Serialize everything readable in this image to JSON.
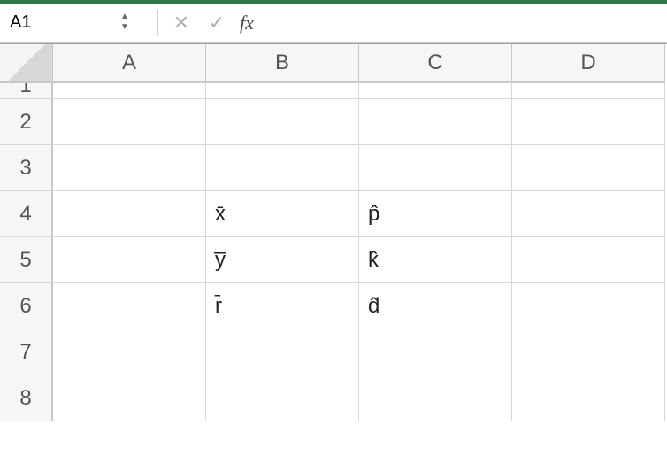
{
  "formula_bar": {
    "cell_reference": "A1",
    "cancel_icon": "✕",
    "accept_icon": "✓",
    "fx_label": "fx",
    "formula_value": ""
  },
  "grid": {
    "columns": [
      "A",
      "B",
      "C",
      "D"
    ],
    "row_numbers": [
      1,
      2,
      3,
      4,
      5,
      6,
      7,
      8
    ],
    "cells": {
      "B4": "x̄",
      "B5": "y̅",
      "B6": "r̄",
      "C4": "p̂",
      "C5": "k̂",
      "C6": "d̂"
    }
  }
}
